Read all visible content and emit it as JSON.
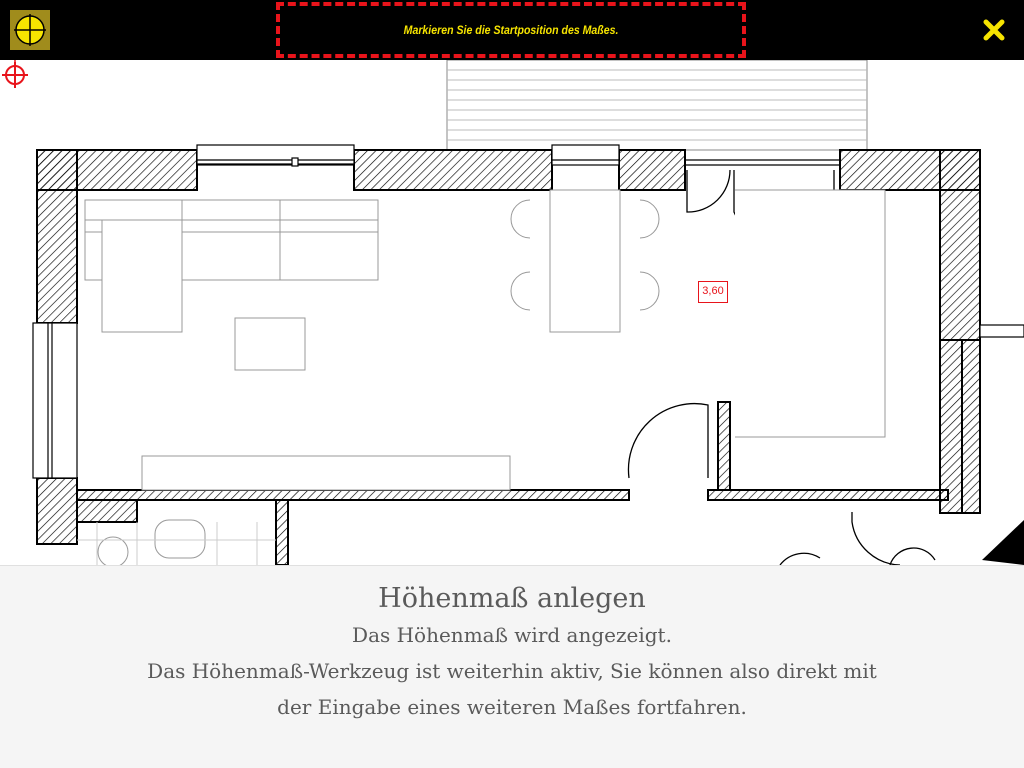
{
  "toolbar": {
    "tool_icon": "crosshair-circle-icon",
    "tool_color": "#a08c1c",
    "instruction": "Markieren Sie die Startposition des Maßes.",
    "instruction_color": "#f6e400",
    "banner_border_color": "#e8141b",
    "close_icon": "close-x-icon"
  },
  "plan": {
    "dimension_value": "3,60",
    "marker_color": "#e8141b",
    "marker_icon": "crosshair-target-icon"
  },
  "help": {
    "title": "Höhenmaß anlegen",
    "lines": [
      "Das Höhenmaß wird angezeigt.",
      "Das Höhenmaß-Werkzeug ist weiterhin aktiv, Sie können also direkt mit",
      "der Eingabe eines weiteren Maßes fortfahren."
    ]
  }
}
